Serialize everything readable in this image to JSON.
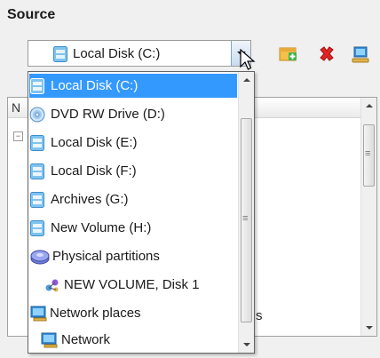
{
  "section": {
    "title": "Source"
  },
  "combo": {
    "value": "Local Disk (C:)",
    "icon": "disk-icon"
  },
  "toolbar": {
    "items": [
      {
        "name": "add-icon",
        "color": "#e8a93c"
      },
      {
        "name": "delete-icon",
        "color": "#e02424"
      },
      {
        "name": "computer-user-icon",
        "color": "#3a8fd8"
      }
    ]
  },
  "background_list": {
    "header": "N",
    "tail_text": "s"
  },
  "dropdown": {
    "items": [
      {
        "label": "Local Disk (C:)",
        "icon": "disk-icon",
        "selected": true
      },
      {
        "label": "DVD RW Drive (D:)",
        "icon": "dvd-icon",
        "selected": false
      },
      {
        "label": "Local Disk (E:)",
        "icon": "disk-icon",
        "selected": false
      },
      {
        "label": "Local Disk (F:)",
        "icon": "disk-icon",
        "selected": false
      },
      {
        "label": "Archives (G:)",
        "icon": "disk-icon",
        "selected": false
      },
      {
        "label": "New Volume (H:)",
        "icon": "disk-icon",
        "selected": false
      },
      {
        "label": "Physical partitions",
        "icon": "physical-partitions-icon",
        "selected": false
      },
      {
        "label": "NEW VOLUME, Disk 1",
        "icon": "partition-icon",
        "selected": false
      },
      {
        "label": "Network places",
        "icon": "network-places-icon",
        "selected": false
      },
      {
        "label": "Network",
        "icon": "network-icon",
        "selected": false
      }
    ]
  },
  "colors": {
    "selection": "#3399ff",
    "disk_blue": "#5ab0e8"
  }
}
